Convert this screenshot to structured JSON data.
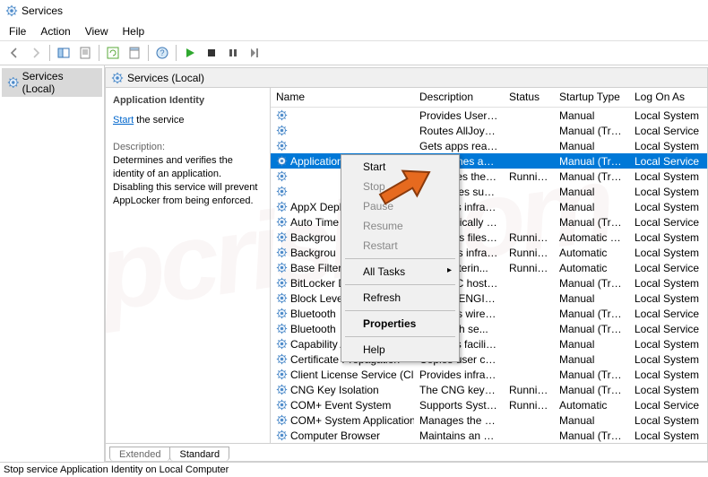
{
  "window": {
    "title": "Services"
  },
  "menu": {
    "file": "File",
    "action": "Action",
    "view": "View",
    "help": "Help"
  },
  "tree": {
    "root": "Services (Local)"
  },
  "pane": {
    "header": "Services (Local)"
  },
  "detail": {
    "service_name": "Application Identity",
    "start_link": "Start",
    "start_suffix": " the service",
    "desc_label": "Description:",
    "desc_text": "Determines and verifies the identity of an application. Disabling this service will prevent AppLocker from being enforced."
  },
  "columns": {
    "name": "Name",
    "description": "Description",
    "status": "Status",
    "startup": "Startup Type",
    "logon": "Log On As"
  },
  "rows": [
    {
      "name": "",
      "desc": "Provides User Acc...",
      "status": "",
      "startup": "Manual",
      "logon": "Local System"
    },
    {
      "name": "",
      "desc": "Routes AllJoyn me...",
      "status": "",
      "startup": "Manual (Trigg...",
      "logon": "Local Service"
    },
    {
      "name": "",
      "desc": "Gets apps ready f...",
      "status": "",
      "startup": "Manual",
      "logon": "Local System"
    },
    {
      "name": "Application",
      "desc": "Determines and v...",
      "status": "",
      "startup": "Manual (Trigg...",
      "logon": "Local Service",
      "selected": true
    },
    {
      "name": "",
      "desc": "Facilitates the ru...",
      "status": "Running",
      "startup": "Manual (Trigg...",
      "logon": "Local System"
    },
    {
      "name": "",
      "desc": "Processes support ...",
      "status": "",
      "startup": "Manual",
      "logon": "Local System"
    },
    {
      "name": "AppX Depl",
      "desc": "Provides infrastru...",
      "status": "",
      "startup": "Manual",
      "logon": "Local System"
    },
    {
      "name": "Auto Time",
      "desc": "Automatically set...",
      "status": "",
      "startup": "Manual (Trigg...",
      "logon": "Local Service"
    },
    {
      "name": "Backgrou",
      "desc": "Transfers files in t...",
      "status": "Running",
      "startup": "Automatic (De...",
      "logon": "Local System"
    },
    {
      "name": "Backgrou",
      "desc": "Windows infrastr...",
      "status": "Running",
      "startup": "Automatic",
      "logon": "Local System"
    },
    {
      "name": "Base Filter",
      "desc": "Base Filterin...",
      "status": "Running",
      "startup": "Automatic",
      "logon": "Local Service"
    },
    {
      "name": "BitLocker D",
      "desc": "BDESVC hosts th...",
      "status": "",
      "startup": "Manual (Trigg...",
      "logon": "Local System"
    },
    {
      "name": "Block Leve",
      "desc": "The WBENGINE s...",
      "status": "",
      "startup": "Manual",
      "logon": "Local System"
    },
    {
      "name": "Bluetooth",
      "desc": "Supports wireless ...",
      "status": "",
      "startup": "Manual (Trigg...",
      "logon": "Local Service"
    },
    {
      "name": "Bluetooth",
      "desc": "Bluetooth se...",
      "status": "",
      "startup": "Manual (Trigg...",
      "logon": "Local Service"
    },
    {
      "name": "Capability Access Manager S...",
      "desc": "Provides facilities...",
      "status": "",
      "startup": "Manual",
      "logon": "Local System"
    },
    {
      "name": "Certificate Propagation",
      "desc": "Copies user certif...",
      "status": "",
      "startup": "Manual",
      "logon": "Local System"
    },
    {
      "name": "Client License Service (ClipSV...",
      "desc": "Provides infrastru...",
      "status": "",
      "startup": "Manual (Trigg...",
      "logon": "Local System"
    },
    {
      "name": "CNG Key Isolation",
      "desc": "The CNG key isol...",
      "status": "Running",
      "startup": "Manual (Trigg...",
      "logon": "Local System"
    },
    {
      "name": "COM+ Event System",
      "desc": "Supports System ...",
      "status": "Running",
      "startup": "Automatic",
      "logon": "Local Service"
    },
    {
      "name": "COM+ System Application",
      "desc": "Manages the con...",
      "status": "",
      "startup": "Manual",
      "logon": "Local System"
    },
    {
      "name": "Computer Browser",
      "desc": "Maintains an up...",
      "status": "",
      "startup": "Manual (Trigg...",
      "logon": "Local System"
    }
  ],
  "context_menu": {
    "start": "Start",
    "stop": "Stop",
    "pause": "Pause",
    "resume": "Resume",
    "restart": "Restart",
    "all_tasks": "All Tasks",
    "refresh": "Refresh",
    "properties": "Properties",
    "help": "Help"
  },
  "tabs": {
    "extended": "Extended",
    "standard": "Standard"
  },
  "statusbar": {
    "text": "Stop service Application Identity on Local Computer"
  }
}
